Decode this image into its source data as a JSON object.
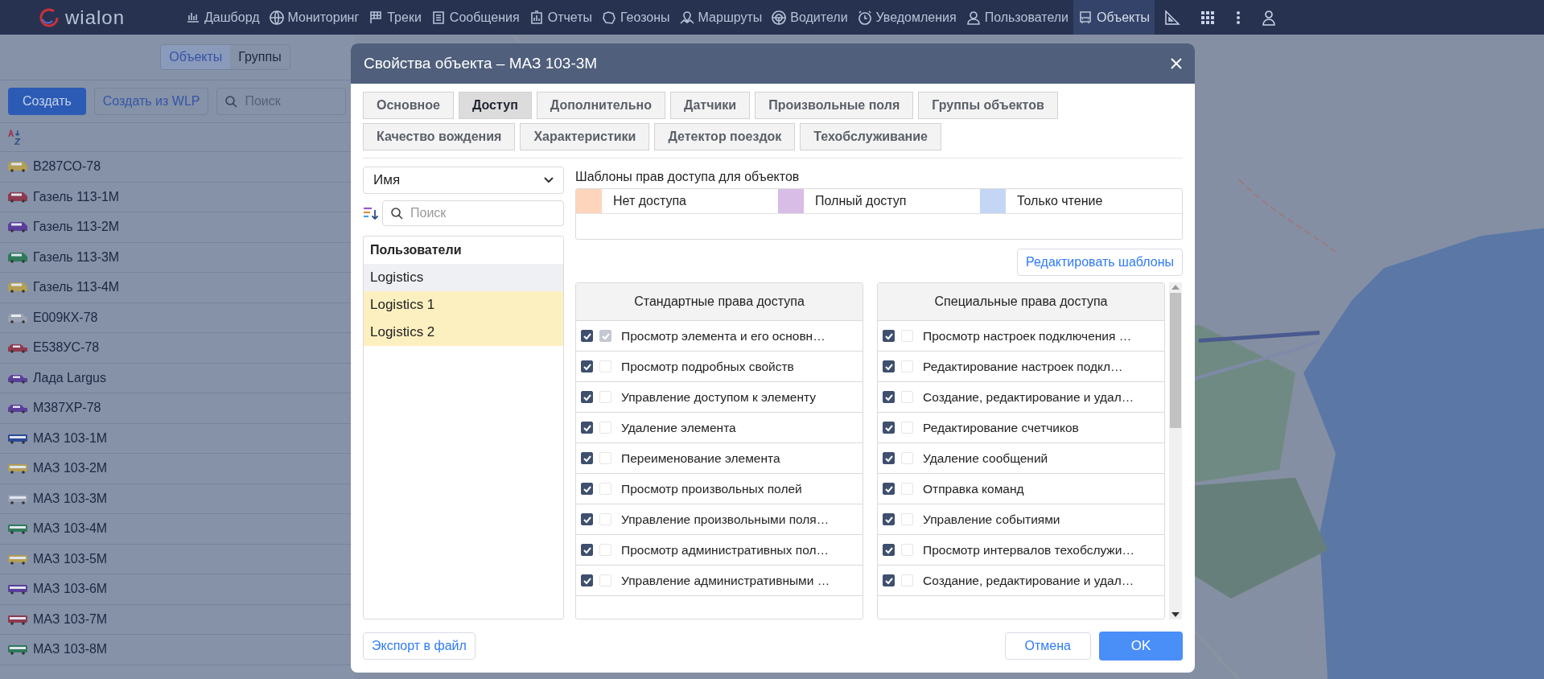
{
  "nav": {
    "logo": "wialon",
    "items": [
      {
        "label": "Дашборд",
        "selected": false
      },
      {
        "label": "Мониторинг",
        "selected": false
      },
      {
        "label": "Треки",
        "selected": false
      },
      {
        "label": "Сообщения",
        "selected": false
      },
      {
        "label": "Отчеты",
        "selected": false
      },
      {
        "label": "Геозоны",
        "selected": false
      },
      {
        "label": "Маршруты",
        "selected": false
      },
      {
        "label": "Водители",
        "selected": false
      },
      {
        "label": "Уведомления",
        "selected": false
      },
      {
        "label": "Пользователи",
        "selected": false
      },
      {
        "label": "Объекты",
        "selected": true
      }
    ]
  },
  "left_panel": {
    "switch": [
      {
        "label": "Объекты",
        "selected": true
      },
      {
        "label": "Группы",
        "selected": false
      }
    ],
    "create_button": "Создать",
    "create_wlp_button": "Создать из WLP",
    "search": {
      "placeholder": "Поиск"
    },
    "units": [
      {
        "name": "В287СО-78",
        "kind": "van",
        "color": "#b39f55"
      },
      {
        "name": "Газель 113-1М",
        "kind": "van",
        "color": "#8e3a4f"
      },
      {
        "name": "Газель 113-2М",
        "kind": "van",
        "color": "#5b3e9a"
      },
      {
        "name": "Газель 113-3М",
        "kind": "van",
        "color": "#2f7a5a"
      },
      {
        "name": "Газель 113-4М",
        "kind": "van",
        "color": "#b39f55"
      },
      {
        "name": "Е009КХ-78",
        "kind": "suv",
        "color": "#9aa2b2"
      },
      {
        "name": "Е538УС-78",
        "kind": "car",
        "color": "#8e3a4f"
      },
      {
        "name": "Лада Largus",
        "kind": "car",
        "color": "#5b3e9a"
      },
      {
        "name": "М387ХР-78",
        "kind": "car",
        "color": "#5b3e9a"
      },
      {
        "name": "МАЗ 103-1М",
        "kind": "bus",
        "color": "#2d4894"
      },
      {
        "name": "МАЗ 103-2М",
        "kind": "bus",
        "color": "#b39f55"
      },
      {
        "name": "МАЗ 103-3М",
        "kind": "bus",
        "color": "#9aa2b2"
      },
      {
        "name": "МАЗ 103-4М",
        "kind": "bus",
        "color": "#2f7a5a"
      },
      {
        "name": "МАЗ 103-5М",
        "kind": "bus",
        "color": "#b39f55"
      },
      {
        "name": "МАЗ 103-6М",
        "kind": "bus",
        "color": "#5b3e9a"
      },
      {
        "name": "МАЗ 103-7М",
        "kind": "bus",
        "color": "#8e3a4f"
      },
      {
        "name": "МАЗ 103-8М",
        "kind": "bus",
        "color": "#2f7a5a"
      }
    ]
  },
  "dialog": {
    "title": "Свойства объекта – МАЗ 103-3М",
    "tabs": [
      {
        "label": "Основное",
        "selected": false
      },
      {
        "label": "Доступ",
        "selected": true
      },
      {
        "label": "Дополнительно",
        "selected": false
      },
      {
        "label": "Датчики",
        "selected": false
      },
      {
        "label": "Произвольные поля",
        "selected": false
      },
      {
        "label": "Группы объектов",
        "selected": false
      },
      {
        "label": "Качество вождения",
        "selected": false
      },
      {
        "label": "Характеристики",
        "selected": false
      },
      {
        "label": "Детектор поездок",
        "selected": false
      },
      {
        "label": "Техобслуживание",
        "selected": false
      }
    ],
    "sort_select": "Имя",
    "search": {
      "placeholder": "Поиск"
    },
    "users_header": "Пользователи",
    "users": [
      {
        "name": "Logistics",
        "selected": true,
        "highlighted": false
      },
      {
        "name": "Logistics 1",
        "selected": false,
        "highlighted": true
      },
      {
        "name": "Logistics 2",
        "selected": false,
        "highlighted": true
      }
    ],
    "templates_title": "Шаблоны прав доступа для объектов",
    "templates": [
      {
        "label": "Нет доступа",
        "color": "#fdd5bd"
      },
      {
        "label": "Полный доступ",
        "color": "#d8bde6"
      },
      {
        "label": "Только чтение",
        "color": "#c3d6f4"
      }
    ],
    "edit_templates_button": "Редактировать шаблоны",
    "standard": {
      "title": "Стандартные права доступа",
      "rows": [
        {
          "label": "Просмотр элемента и его основн…",
          "checked": true,
          "inherited": true
        },
        {
          "label": "Просмотр подробных свойств",
          "checked": true,
          "inherited": false
        },
        {
          "label": "Управление доступом к элементу",
          "checked": true,
          "inherited": false
        },
        {
          "label": "Удаление элемента",
          "checked": true,
          "inherited": false
        },
        {
          "label": "Переименование элемента",
          "checked": true,
          "inherited": false
        },
        {
          "label": "Просмотр произвольных полей",
          "checked": true,
          "inherited": false
        },
        {
          "label": "Управление произвольными поля…",
          "checked": true,
          "inherited": false
        },
        {
          "label": "Просмотр административных пол…",
          "checked": true,
          "inherited": false
        },
        {
          "label": "Управление административными …",
          "checked": true,
          "inherited": false
        }
      ]
    },
    "special": {
      "title": "Специальные права доступа",
      "rows": [
        {
          "label": "Просмотр настроек подключения …",
          "checked": true,
          "inherited": false
        },
        {
          "label": "Редактирование настроек подкл…",
          "checked": true,
          "inherited": false
        },
        {
          "label": "Создание, редактирование и удал…",
          "checked": true,
          "inherited": false
        },
        {
          "label": "Редактирование счетчиков",
          "checked": true,
          "inherited": false
        },
        {
          "label": "Удаление сообщений",
          "checked": true,
          "inherited": false
        },
        {
          "label": "Отправка команд",
          "checked": true,
          "inherited": false
        },
        {
          "label": "Управление событиями",
          "checked": true,
          "inherited": false
        },
        {
          "label": "Просмотр интервалов техобслужи…",
          "checked": true,
          "inherited": false
        },
        {
          "label": "Создание, редактирование и удал…",
          "checked": true,
          "inherited": false
        }
      ]
    },
    "export_button": "Экспорт в файл",
    "cancel_button": "Отмена",
    "ok_button": "OK"
  }
}
